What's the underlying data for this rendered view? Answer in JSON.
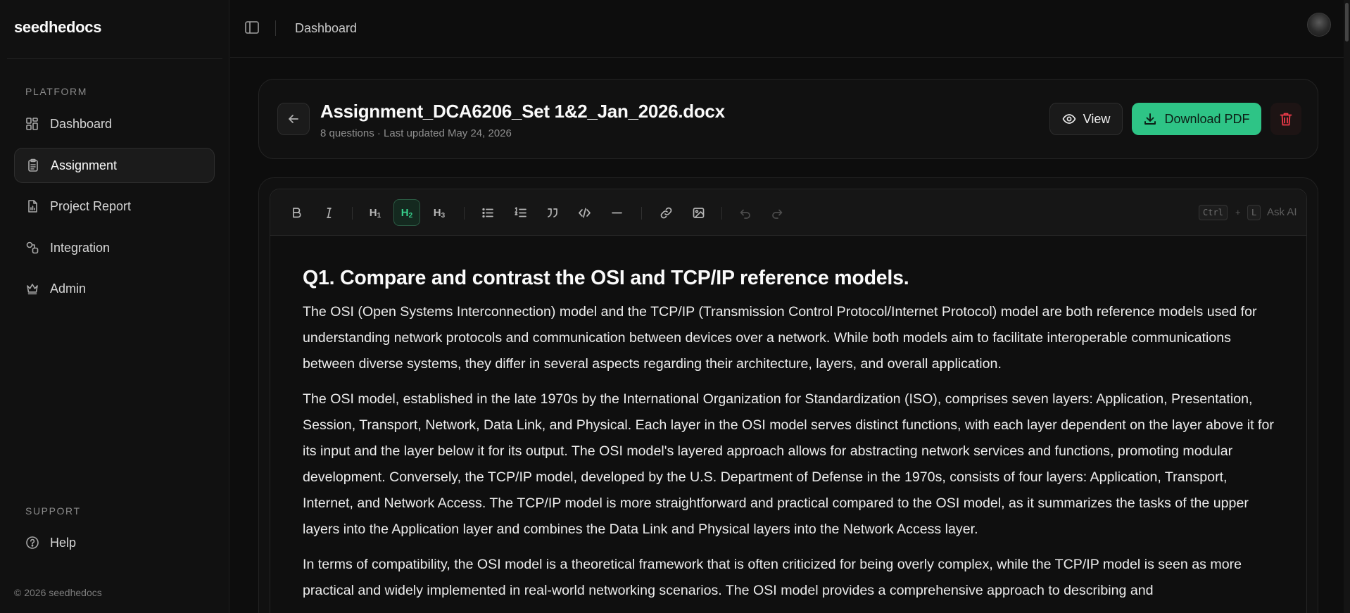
{
  "app": {
    "brand": "seedhedocs",
    "copyright": "© 2026 seedhedocs"
  },
  "sidebar": {
    "platform_label": "PLATFORM",
    "items": [
      {
        "label": "Dashboard",
        "icon": "grid-icon"
      },
      {
        "label": "Assignment",
        "icon": "clipboard-icon",
        "active": true
      },
      {
        "label": "Project Report",
        "icon": "report-icon"
      },
      {
        "label": "Integration",
        "icon": "integration-icon"
      },
      {
        "label": "Admin",
        "icon": "crown-icon"
      }
    ],
    "support_label": "SUPPORT",
    "support_items": [
      {
        "label": "Help",
        "icon": "help-circle-icon"
      }
    ]
  },
  "topbar": {
    "breadcrumb": "Dashboard"
  },
  "document": {
    "title": "Assignment_DCA6206_Set 1&2_Jan_2026.docx",
    "meta": "8 questions · Last updated May 24, 2026",
    "view_label": "View",
    "download_label": "Download PDF"
  },
  "toolbar": {
    "h1": "H",
    "h1_sub": "1",
    "h2": "H",
    "h2_sub": "2",
    "h3": "H",
    "h3_sub": "3",
    "shortcut_key1": "Ctrl",
    "shortcut_plus": "+",
    "shortcut_key2": "L",
    "ask_ai": "Ask AI"
  },
  "content": {
    "heading": "Q1. Compare and contrast the OSI and TCP/IP reference models.",
    "paragraphs": [
      "The OSI (Open Systems Interconnection) model and the TCP/IP (Transmission Control Protocol/Internet Protocol) model are both reference models used for understanding network protocols and communication between devices over a network. While both models aim to facilitate interoperable communications between diverse systems, they differ in several aspects regarding their architecture, layers, and overall application.",
      "The OSI model, established in the late 1970s by the International Organization for Standardization (ISO), comprises seven layers: Application, Presentation, Session, Transport, Network, Data Link, and Physical. Each layer in the OSI model serves distinct functions, with each layer dependent on the layer above it for its input and the layer below it for its output. The OSI model's layered approach allows for abstracting network services and functions, promoting modular development. Conversely, the TCP/IP model, developed by the U.S. Department of Defense in the 1970s, consists of four layers: Application, Transport, Internet, and Network Access. The TCP/IP model is more straightforward and practical compared to the OSI model, as it summarizes the tasks of the upper layers into the Application layer and combines the Data Link and Physical layers into the Network Access layer.",
      "In terms of compatibility, the OSI model is a theoretical framework that is often criticized for being overly complex, while the TCP/IP model is seen as more practical and widely implemented in real-world networking scenarios. The OSI model provides a comprehensive approach to describing and"
    ]
  },
  "colors": {
    "accent": "#2ec486",
    "danger": "#ef3b4a",
    "background": "#0d0d0d"
  }
}
